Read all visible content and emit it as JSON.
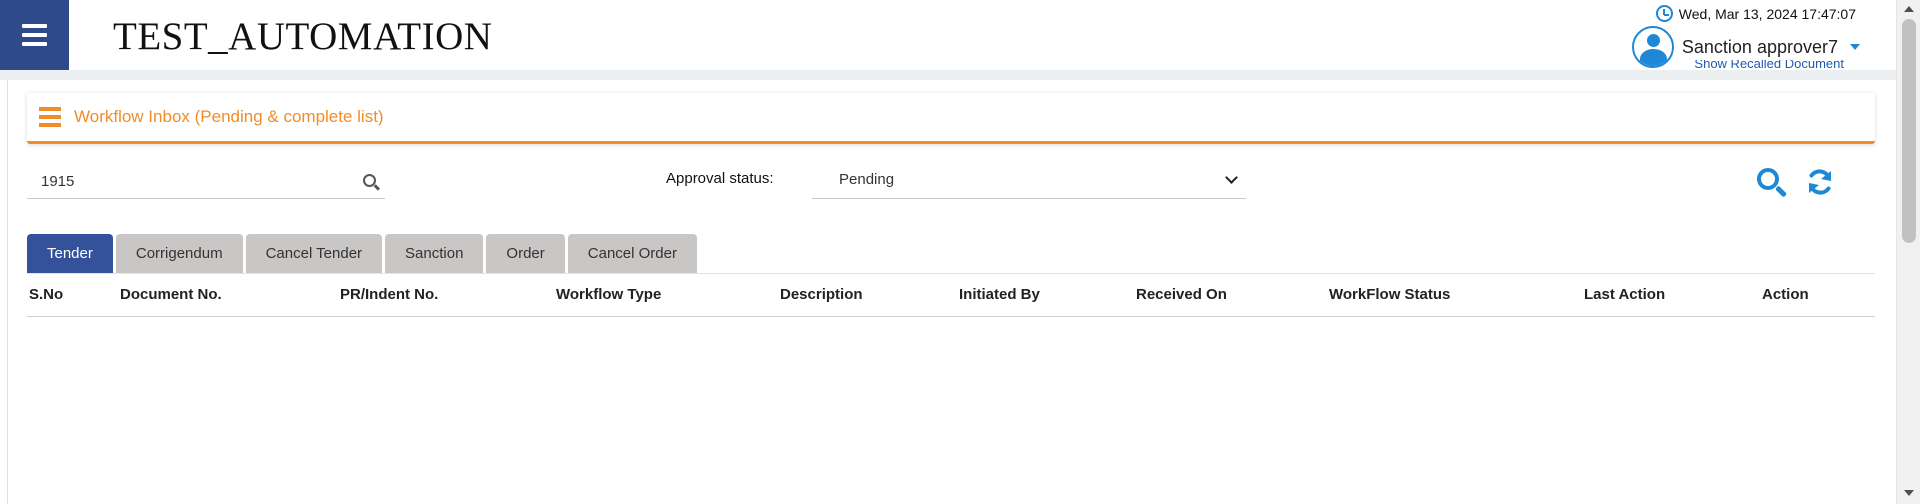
{
  "header": {
    "app_title": "TEST_AUTOMATION",
    "datetime": "Wed, Mar 13, 2024 17:47:07",
    "user_name": "Sanction approver7",
    "show_recalled_label": "Show Recalled Document"
  },
  "panel": {
    "title": "Workflow Inbox (Pending & complete list)"
  },
  "filters": {
    "search_value": "1915",
    "approval_status_label": "Approval status:",
    "approval_status_value": "Pending"
  },
  "tabs": [
    {
      "label": "Tender",
      "active": true
    },
    {
      "label": "Corrigendum",
      "active": false
    },
    {
      "label": "Cancel Tender",
      "active": false
    },
    {
      "label": "Sanction",
      "active": false
    },
    {
      "label": "Order",
      "active": false
    },
    {
      "label": "Cancel Order",
      "active": false
    }
  ],
  "table": {
    "columns": [
      "S.No",
      "Document No.",
      "PR/Indent No.",
      "Workflow Type",
      "Description",
      "Initiated By",
      "Received On",
      "WorkFlow Status",
      "Last Action",
      "Action"
    ],
    "rows": []
  },
  "colors": {
    "accent": "#f28c28",
    "primary": "#34519b",
    "icon_blue": "#1e88d6",
    "menu_bg": "#2e4a8a"
  }
}
